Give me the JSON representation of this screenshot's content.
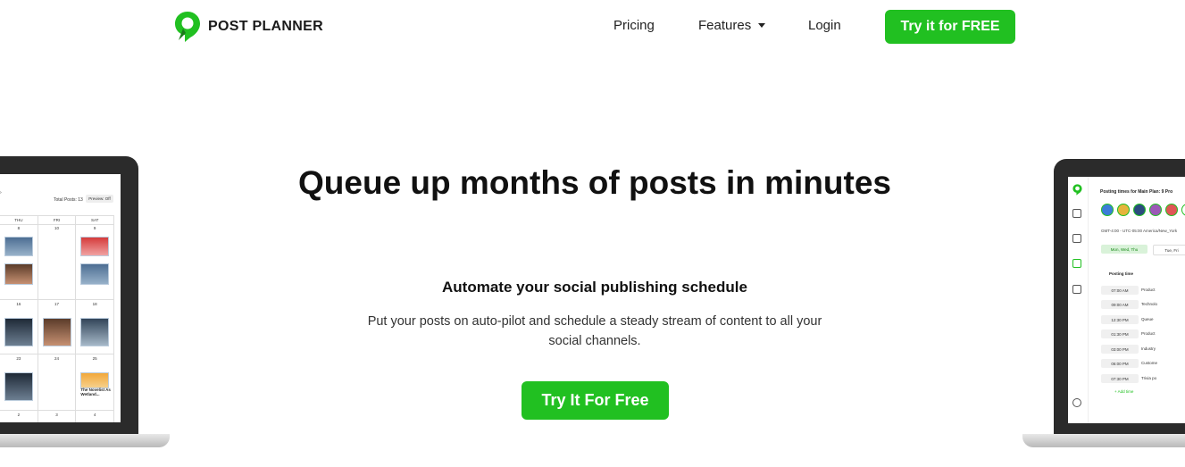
{
  "header": {
    "brand": "POST PLANNER",
    "nav": {
      "pricing": "Pricing",
      "features": "Features",
      "login": "Login"
    },
    "cta": "Try it for FREE"
  },
  "hero": {
    "title": "Queue up months of posts in minutes",
    "subtitle": "Automate your social publishing schedule",
    "description": "Put your posts on auto-pilot and schedule a steady stream of content to all your social channels.",
    "cta": "Try It For Free"
  },
  "left_screen": {
    "total_posts": "Total Posts: 13",
    "preview": "Preview: Off",
    "days": [
      "THU",
      "FRI",
      "SAT"
    ],
    "rows": [
      [
        "8",
        "10",
        "9"
      ],
      [
        "16",
        "17",
        "18"
      ],
      [
        "23",
        "24",
        "25"
      ],
      [
        "2",
        "3",
        "4"
      ]
    ],
    "post_title": "The Novelist As Wetland..."
  },
  "right_screen": {
    "heading": "Posting times for  Main Plan: 9 Pro",
    "timezone": "GMT-4:00 - UTC-05:00 America/New_York",
    "day_pills": [
      "Mon, Wed, Thu",
      "Tue, Fri"
    ],
    "column_title": "Posting time",
    "times": [
      "07:00 AM",
      "09:00 AM",
      "12:30 PM",
      "01:30 PM",
      "03:00 PM",
      "06:00 PM",
      "07:30 PM"
    ],
    "labels": [
      "Product",
      "Technolo",
      "Queue",
      "Product",
      "Industry",
      "Custome",
      "Trivia po"
    ],
    "add_time": "+ Add time"
  },
  "colors": {
    "brand_green": "#21c021",
    "text_dark": "#111111"
  }
}
